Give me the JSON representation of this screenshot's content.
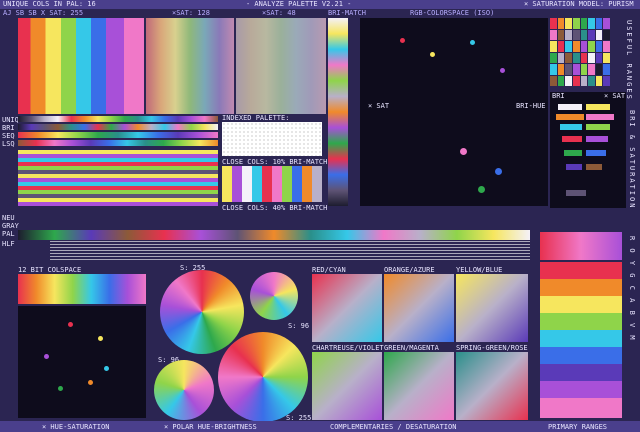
{
  "header": {
    "unique_cols": "UNIQUE COLS IN PAL: 16",
    "title": "- ANALYZE PALETTE V2.21 -",
    "sat_model": "× SATURATION MODEL: PURISM"
  },
  "subheader": {
    "left": "AJ SB SB  X SAT: 255",
    "sat128": "×SAT: 128",
    "sat48": "×SAT: 48",
    "brimatch": "BRI-MATCH",
    "rgb": "RGB-COLORSPACE (ISO)"
  },
  "left_side": {
    "unique": "UNIQUE",
    "bri": "BRI",
    "seq": "SEQ",
    "lsq": "LSQ",
    "neu_gray": "NEU GRAY",
    "pal": "PAL",
    "hlf": "HLF"
  },
  "right_side": {
    "useful_ranges": "USEFUL RANGES",
    "bri_sat": "BRI & SATURATION",
    "hue_letters": "R O Y G C A B V M"
  },
  "panels": {
    "indexed_palette": "INDEXED PALETTE:",
    "close_cols_10": "CLOSE COLS: 10% BRI-MATCH",
    "close_cols_40": "CLOSE COLS: 40% BRI-MATCH",
    "sat_label": "× SAT",
    "bri_hue": "BRI-HUE",
    "bri_tag": "BRI",
    "sat_tag": "× SAT",
    "colspace12": "12 BIT COLSPACE",
    "s255a": "S: 255",
    "s96a": "S: 96",
    "s96b": "S: 96",
    "s255b": "S: 255"
  },
  "complements": {
    "red_cyan": "RED/CYAN",
    "orange_azure": "ORANGE/AZURE",
    "yellow_blue": "YELLOW/BLUE",
    "chartreuse_violet": "CHARTREUSE/VIOLET",
    "green_magenta": "GREEN/MAGENTA",
    "spring_rose": "SPRING-GREEN/ROSE"
  },
  "footer": {
    "hue_sat": "× HUE-SATURATION",
    "polar": "× POLAR HUE-BRIGHTNESS",
    "complementaries": "COMPLEMENTARIES / DESATURATION",
    "primary": "PRIMARY RANGES"
  },
  "palette": [
    "#1d1c2f",
    "#5e5375",
    "#b8b0c9",
    "#f4f1f9",
    "#e8314f",
    "#f08a2a",
    "#f6e65e",
    "#8fd44a",
    "#2ea84c",
    "#2a8f8a",
    "#35c8e8",
    "#3a6ee8",
    "#5a3ab8",
    "#a850d8",
    "#f078c8",
    "#8c5a38"
  ]
}
